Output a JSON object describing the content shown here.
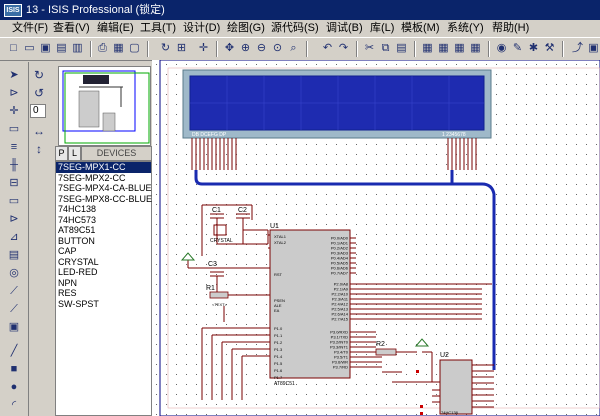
{
  "window": {
    "app_icon_text": "ISIS",
    "title": "13 - ISIS Professional (锁定)"
  },
  "menu": [
    "文件(F)",
    "查看(V)",
    "编辑(E)",
    "工具(T)",
    "设计(D)",
    "绘图(G)",
    "源代码(S)",
    "调试(B)",
    "库(L)",
    "模板(M)",
    "系统(Y)",
    "帮助(H)"
  ],
  "rotation": {
    "angle": "0"
  },
  "devices": {
    "tab_p": "P",
    "tab_l": "L",
    "header": "DEVICES",
    "items": [
      "7SEG-MPX1-CC",
      "7SEG-MPX2-CC",
      "7SEG-MPX4-CA-BLUE",
      "7SEG-MPX8-CC-BLUE",
      "74HC138",
      "74HC573",
      "AT89C51",
      "BUTTON",
      "CAP",
      "CRYSTAL",
      "LED-RED",
      "NPN",
      "RES",
      "SW-SPST"
    ],
    "selected_index": 0
  },
  "schematic": {
    "lcd_left_label": "DB DCEFG DP",
    "lcd_right_label": "1 2345678",
    "c1": "C1",
    "c2": "C2",
    "c3": "C3",
    "x1": "X1",
    "crystal": "CRYSTAL",
    "r1": "R1",
    "r2": "R2",
    "u1": "U1",
    "u2": "U2",
    "u1_left_pins": [
      "XTAL1",
      "XTAL2",
      "RST",
      "PSEN",
      "ALE",
      "EA",
      "P1.0",
      "P1.1",
      "P1.2",
      "P1.3",
      "P1.4",
      "P1.5",
      "P1.6",
      "P1.7"
    ],
    "u1_right_pins": [
      "P0.0/AD0",
      "P0.1/AD1",
      "P0.2/AD2",
      "P0.3/AD3",
      "P0.4/AD4",
      "P0.5/AD5",
      "P0.6/AD6",
      "P0.7/AD7",
      "P2.0/A8",
      "P2.1/A9",
      "P2.2/A10",
      "P2.3/A11",
      "P2.4/A12",
      "P2.5/A13",
      "P2.6/A14",
      "P2.7/A15",
      "P3.0/RXD",
      "P3.1/TXD",
      "P3.2/INT0",
      "P3.3/INT1",
      "P3.4/T0",
      "P3.5/T1",
      "P3.6/WR",
      "P3.7/RD"
    ],
    "u1_part": "AT89C51",
    "u2_part": "74HC138",
    "text_hint": "<TEXT>"
  }
}
